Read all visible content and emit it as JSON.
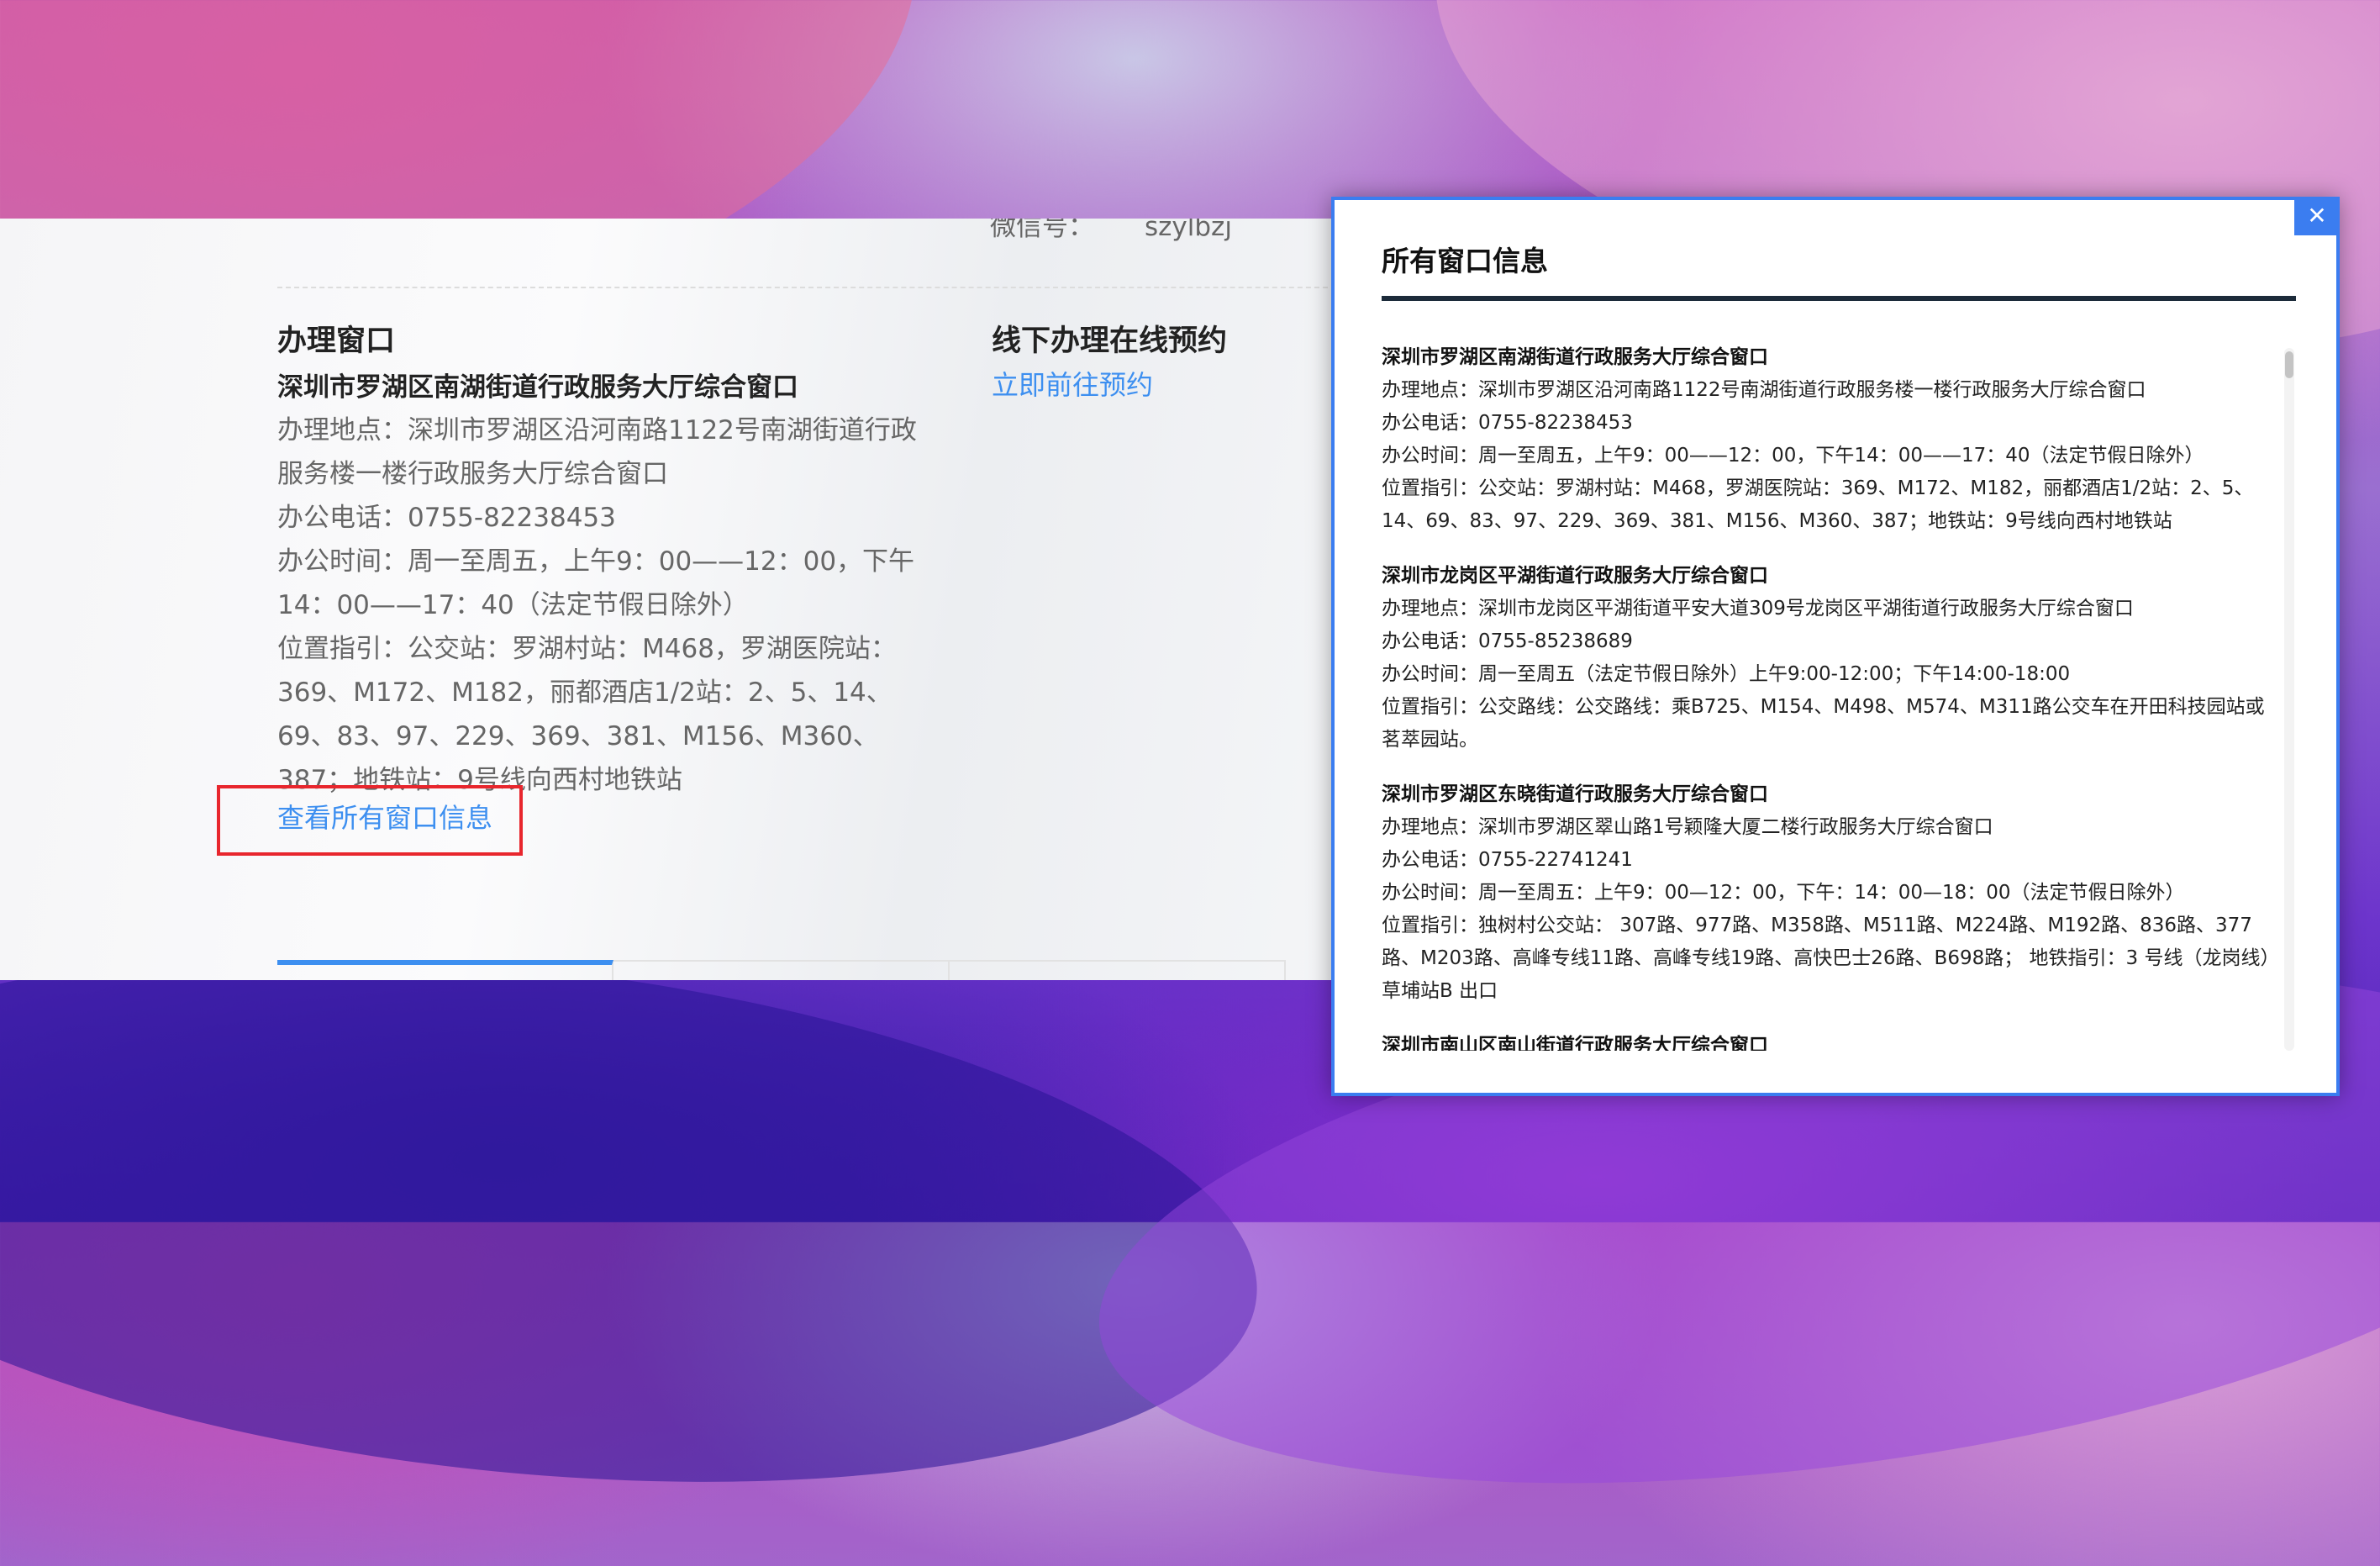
{
  "page": {
    "wechat_label": "微信号：",
    "wechat_value": "szylbzj",
    "window_section": {
      "heading": "办理窗口",
      "name": "深圳市罗湖区南湖街道行政服务大厅综合窗口",
      "address": "办理地点：深圳市罗湖区沿河南路1122号南湖街道行政服务楼一楼行政服务大厅综合窗口",
      "phone": "办公电话：0755-82238453",
      "hours": "办公时间：周一至周五，上午9：00——12：00，下午14：00——17：40（法定节假日除外）",
      "location": "位置指引：公交站：罗湖村站：M468，罗湖医院站：369、M172、M182，丽都酒店1/2站：2、5、14、69、83、97、229、369、381、M156、M360、387；地铁站：9号线向西村地铁站"
    },
    "view_all_link": "查看所有窗口信息",
    "appointment": {
      "title": "线下办理在线预约",
      "link": "立即前往预约"
    }
  },
  "modal": {
    "close_symbol": "✕",
    "title": "所有窗口信息",
    "entries": [
      {
        "name": "深圳市罗湖区南湖街道行政服务大厅综合窗口",
        "address": "办理地点：深圳市罗湖区沿河南路1122号南湖街道行政服务楼一楼行政服务大厅综合窗口",
        "phone": "办公电话：0755-82238453",
        "hours": "办公时间：周一至周五，上午9：00——12：00，下午14：00——17：40（法定节假日除外）",
        "location": "位置指引：公交站：罗湖村站：M468，罗湖医院站：369、M172、M182，丽都酒店1/2站：2、5、14、69、83、97、229、369、381、M156、M360、387；地铁站：9号线向西村地铁站"
      },
      {
        "name": "深圳市龙岗区平湖街道行政服务大厅综合窗口",
        "address": "办理地点：深圳市龙岗区平湖街道平安大道309号龙岗区平湖街道行政服务大厅综合窗口",
        "phone": "办公电话：0755-85238689",
        "hours": "办公时间：周一至周五（法定节假日除外）上午9:00-12:00；下午14:00-18:00",
        "location": "位置指引：公交路线：公交路线：乘B725、M154、M498、M574、M311路公交车在开田科技园站或茗萃园站。"
      },
      {
        "name": "深圳市罗湖区东晓街道行政服务大厅综合窗口",
        "address": "办理地点：深圳市罗湖区翠山路1号颖隆大厦二楼行政服务大厅综合窗口",
        "phone": "办公电话：0755-22741241",
        "hours": "办公时间：周一至周五：上午9：00—12：00，下午：14：00—18：00（法定节假日除外）",
        "location": "位置指引：独树村公交站： 307路、977路、M358路、M511路、M224路、M192路、836路、377路、M203路、高峰专线11路、高峰专线19路、高快巴士26路、B698路； 地铁指引：3 号线（龙岗线）草埔站B 出口"
      },
      {
        "name": "深圳市南山区南山街道行政服务大厅综合窗口",
        "address": "",
        "phone": "",
        "hours": "",
        "location": ""
      }
    ]
  },
  "colors": {
    "link_blue": "#3d8ff0",
    "modal_border": "#3b7df0",
    "highlight_red": "#e8262d"
  }
}
